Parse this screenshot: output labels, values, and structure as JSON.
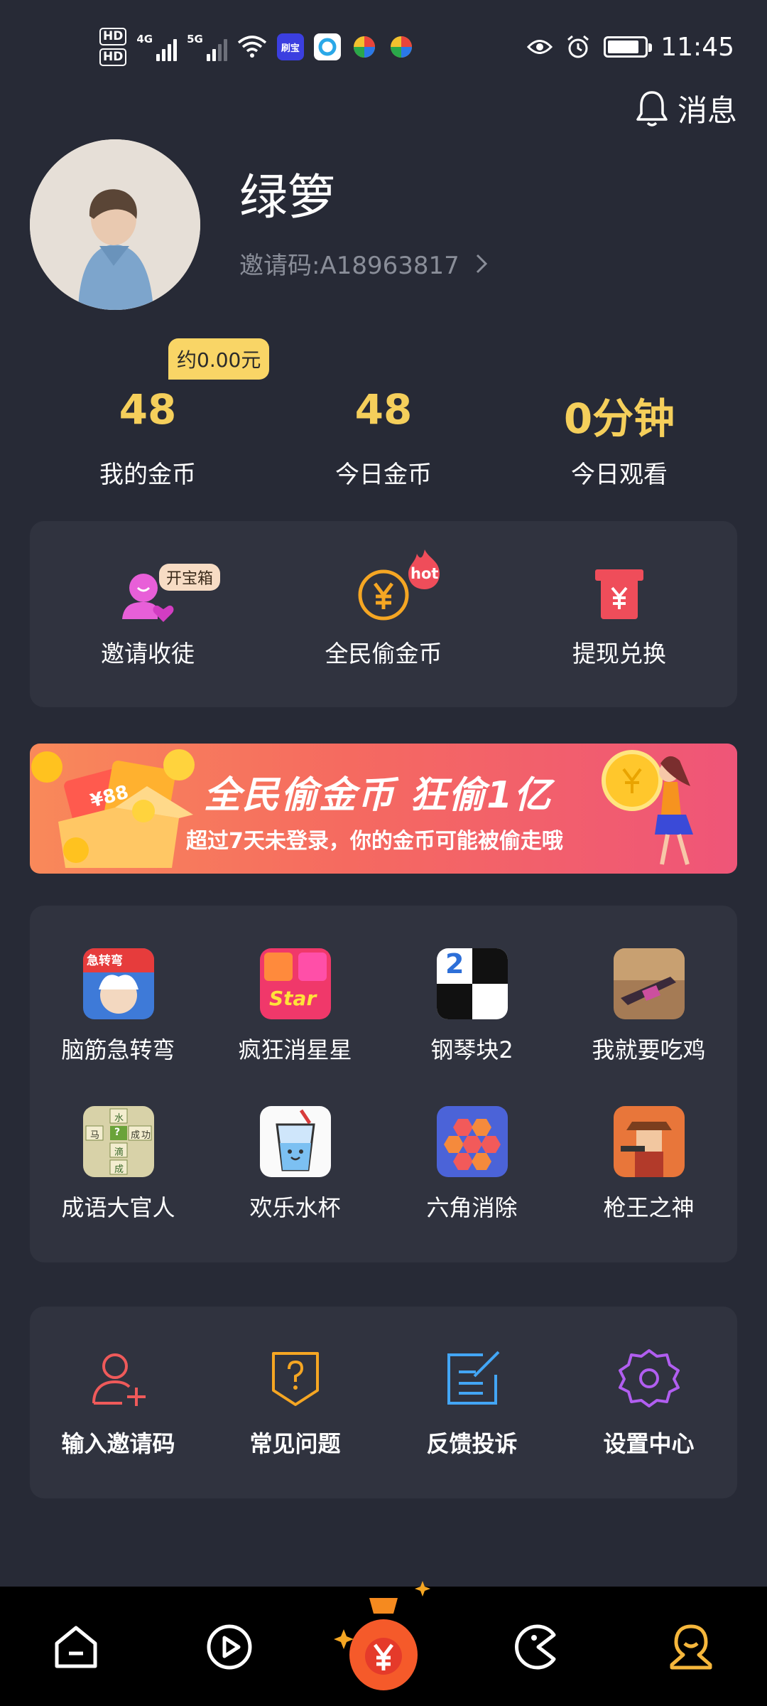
{
  "status_bar": {
    "hd1": "HD",
    "hd2": "HD",
    "net1": "4G",
    "net2": "5G",
    "app_badge": "刷宝",
    "time": "11:45"
  },
  "header": {
    "messages_label": "消息",
    "nickname": "绿箩",
    "invite_code": "邀请码:A18963817"
  },
  "stats": {
    "approx_value": "约0.00元",
    "items": [
      {
        "value": "48",
        "label": "我的金币"
      },
      {
        "value": "48",
        "label": "今日金币"
      },
      {
        "value": "0分钟",
        "label": "今日观看"
      }
    ]
  },
  "actions": {
    "treasure_badge": "开宝箱",
    "hot_badge": "hot",
    "items": [
      {
        "label": "邀请收徒"
      },
      {
        "label": "全民偷金币"
      },
      {
        "label": "提现兑换"
      }
    ]
  },
  "banner": {
    "title": "全民偷金币  狂偷1亿",
    "subtitle": "超过7天未登录，你的金币可能被偷走哦",
    "envelope_text": "¥88"
  },
  "games": [
    {
      "label": "脑筋急转弯"
    },
    {
      "label": "疯狂消星星"
    },
    {
      "label": "钢琴块2"
    },
    {
      "label": "我就要吃鸡"
    },
    {
      "label": "成语大官人"
    },
    {
      "label": "欢乐水杯"
    },
    {
      "label": "六角消除"
    },
    {
      "label": "枪王之神"
    }
  ],
  "game_icon_text": {
    "brain": "急转弯",
    "star": "Star",
    "piano": "2",
    "idiom": [
      "水",
      "马",
      "?",
      "成",
      "功",
      "滴",
      "成"
    ]
  },
  "tools": [
    {
      "label": "输入邀请码"
    },
    {
      "label": "常见问题"
    },
    {
      "label": "反馈投诉"
    },
    {
      "label": "设置中心"
    }
  ],
  "colors": {
    "background": "#272a36",
    "card": "#30333f",
    "gold": "#f5cf5b",
    "nav_active": "#f6b73c"
  },
  "nav_icons": [
    "home-icon",
    "video-icon",
    "money-bag-icon",
    "game-icon",
    "profile-icon"
  ]
}
